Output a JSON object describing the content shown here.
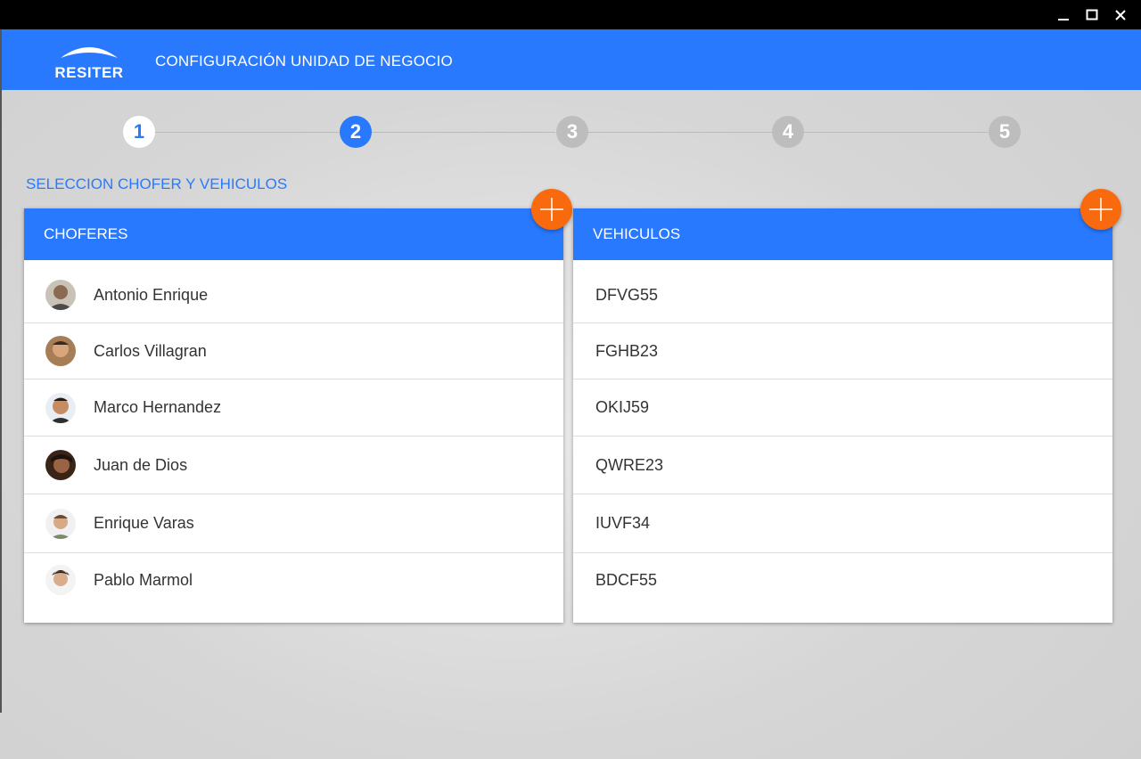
{
  "window": {
    "minimize_icon": "minimize-icon",
    "maximize_icon": "maximize-icon",
    "close_icon": "close-icon"
  },
  "header": {
    "logo_text": "RESITER",
    "title": "CONFIGURACIÓN UNIDAD DE NEGOCIO"
  },
  "stepper": {
    "steps": [
      {
        "label": "1",
        "state": "done"
      },
      {
        "label": "2",
        "state": "active"
      },
      {
        "label": "3",
        "state": "pending"
      },
      {
        "label": "4",
        "state": "pending"
      },
      {
        "label": "5",
        "state": "pending"
      }
    ]
  },
  "section": {
    "title": "SELECCION CHOFER Y VEHICULOS"
  },
  "choferes": {
    "header": "CHOFERES",
    "add_icon": "plus-icon",
    "items": [
      {
        "name": "Antonio Enrique",
        "avatar": "avatar-photo"
      },
      {
        "name": "Carlos Villagran",
        "avatar": "avatar-photo"
      },
      {
        "name": "Marco Hernandez",
        "avatar": "avatar-photo"
      },
      {
        "name": "Juan de Dios",
        "avatar": "avatar-photo"
      },
      {
        "name": "Enrique Varas",
        "avatar": "avatar-photo"
      },
      {
        "name": "Pablo Marmol",
        "avatar": "avatar-photo"
      }
    ]
  },
  "vehiculos": {
    "header": "VEHICULOS",
    "add_icon": "plus-icon",
    "items": [
      {
        "plate": "DFVG55"
      },
      {
        "plate": "FGHB23"
      },
      {
        "plate": "OKIJ59"
      },
      {
        "plate": "QWRE23"
      },
      {
        "plate": "IUVF34"
      },
      {
        "plate": "BDCF55"
      }
    ]
  },
  "colors": {
    "primary": "#2979ff",
    "accent": "#f96a0e",
    "titlebar": "#000000"
  }
}
